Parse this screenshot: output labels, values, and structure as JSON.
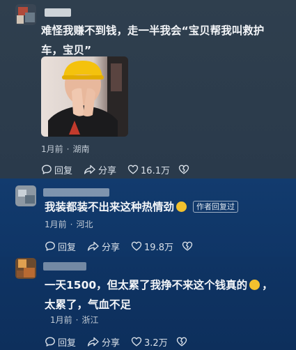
{
  "comments": [
    {
      "text": "难怪我赚不到钱，走一半我会“宝贝帮我叫救护车，宝贝”",
      "time": "1月前",
      "location": "湖南",
      "reply_label": "回复",
      "share_label": "分享",
      "likes": "16.1万"
    },
    {
      "text": "我装都装不出来这种热情劲",
      "author_tag": "作者回复过",
      "time": "1月前",
      "location": "河北",
      "reply_label": "回复",
      "share_label": "分享",
      "likes": "19.8万"
    },
    {
      "text_part1": "一天1500，但太累了我挣不来这个钱真的",
      "text_part2": "，太累了，气血不足",
      "time": "1月前",
      "location": "浙江",
      "reply_label": "回复",
      "share_label": "分享",
      "likes": "3.2万"
    }
  ],
  "separator": "·",
  "icons": {
    "reply": "speech-bubble-icon",
    "share": "share-arrow-icon",
    "like": "heart-icon",
    "dislike": "broken-heart-icon"
  },
  "colors": {
    "panel1": "#2f3f4e",
    "panel2": "#123b6e",
    "panel3": "#0f3464",
    "text": "#f3f5f8",
    "meta": "#c3ccd6"
  }
}
